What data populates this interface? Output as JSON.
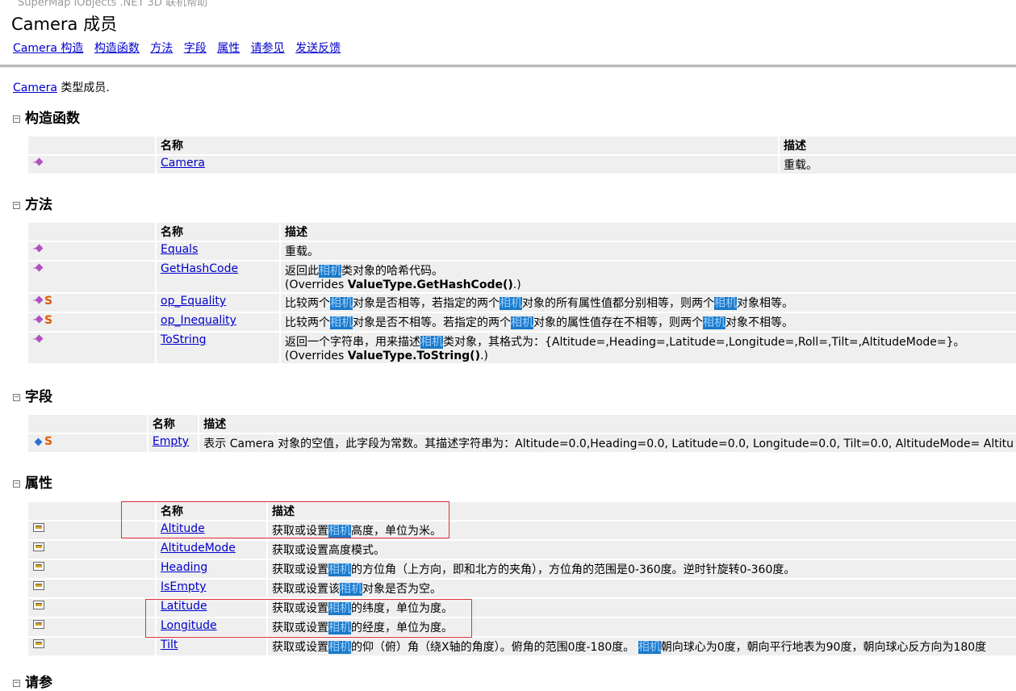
{
  "header": {
    "breadcrumb": "SuperMap iObjects .NET 3D 联机帮助",
    "title": "Camera 成员",
    "links": [
      "Camera 构造",
      "构造函数",
      "方法",
      "字段",
      "属性",
      "请参见",
      "发送反馈"
    ]
  },
  "intro": {
    "link": "Camera",
    "text": " 类型成员."
  },
  "table_headers": {
    "name": "名称",
    "desc": "描述"
  },
  "sections": {
    "constructors": {
      "title": "构造函数",
      "rows": [
        {
          "name": "Camera",
          "desc": "重载。"
        }
      ]
    },
    "methods": {
      "title": "方法",
      "rows": [
        {
          "name": "Equals",
          "desc": "重载。"
        },
        {
          "name": "GetHashCode",
          "desc_pre": "返回此",
          "hl": "相机",
          "desc_post": "类对象的哈希代码。",
          "override_pre": "(Overrides ",
          "override": "ValueType.GetHashCode()",
          "override_post": ".)"
        },
        {
          "name": "op_Equality",
          "desc": "比较两个相机对象是否相等，若指定的两个相机对象的所有属性值都分别相等，则两个相机对象相等。"
        },
        {
          "name": "op_Inequality",
          "desc": "比较两个相机对象是否不相等。若指定的两个相机对象的属性值存在不相等，则两个相机对象不相等。"
        },
        {
          "name": "ToString",
          "desc_pre": "返回一个字符串，用来描述",
          "hl": "相机",
          "desc_post": "类对象，其格式为：{Altitude=,Heading=,Latitude=,Longitude=,Roll=,Tilt=,AltitudeMode=}。",
          "override_pre": "(Overrides ",
          "override": "ValueType.ToString()",
          "override_post": ".)"
        }
      ]
    },
    "fields": {
      "title": "字段",
      "rows": [
        {
          "name": "Empty",
          "desc": "表示 Camera 对象的空值，此字段为常数。其描述字符串为：Altitude=0.0,Heading=0.0, Latitude=0.0, Longitude=0.0, Tilt=0.0, AltitudeMode= Altitu"
        }
      ]
    },
    "properties": {
      "title": "属性",
      "rows": [
        {
          "name": "Altitude",
          "desc": "获取或设置相机高度，单位为米。"
        },
        {
          "name": "AltitudeMode",
          "desc": "获取或设置高度模式。"
        },
        {
          "name": "Heading",
          "desc": "获取或设置相机的方位角（上方向，即和北方的夹角），方位角的范围是0-360度。逆时针旋转0-360度。"
        },
        {
          "name": "IsEmpty",
          "desc": "获取或设置该相机对象是否为空。"
        },
        {
          "name": "Latitude",
          "desc": "获取或设置相机的纬度，单位为度。"
        },
        {
          "name": "Longitude",
          "desc": "获取或设置相机的经度，单位为度。"
        },
        {
          "name": "Tilt",
          "desc": "获取或设置相机的仰（俯）角（绕X轴的角度）。俯角的范围0度-180度。 相机朝向球心为0度，朝向平行地表为90度，朝向球心反方向为180度"
        }
      ]
    },
    "next_section_cut": "请参"
  },
  "colors": {
    "link": "#0000cc",
    "highlight_bg": "#1a7ac9",
    "annotation_box": "#e0303a"
  }
}
